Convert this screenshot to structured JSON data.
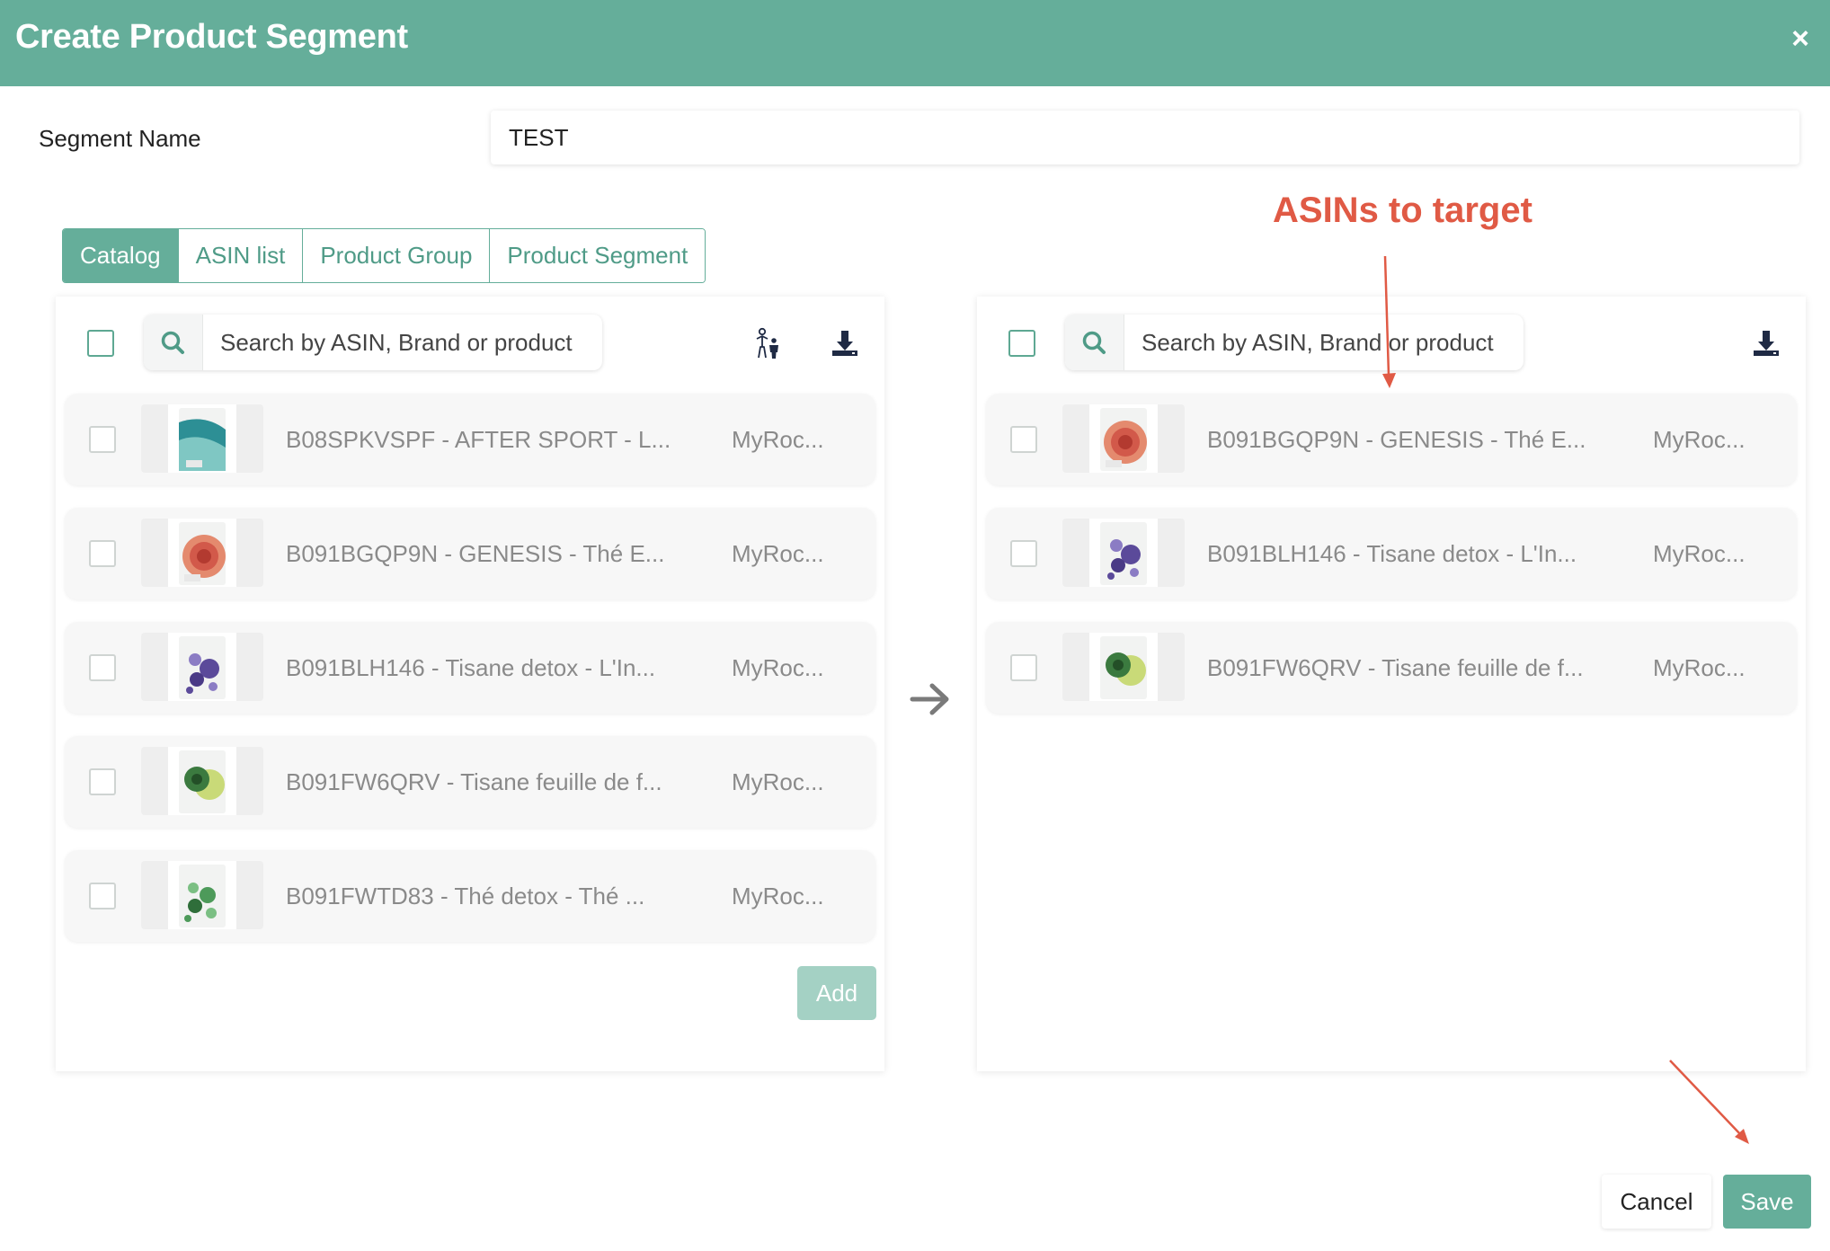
{
  "modal": {
    "title": "Create Product Segment",
    "close_label": "×"
  },
  "segment_name": {
    "label": "Segment Name",
    "value": "TEST"
  },
  "tabs": [
    {
      "label": "Catalog",
      "active": true
    },
    {
      "label": "ASIN list",
      "active": false
    },
    {
      "label": "Product Group",
      "active": false
    },
    {
      "label": "Product Segment",
      "active": false
    }
  ],
  "left_panel": {
    "search_placeholder": "Search by ASIN, Brand or product",
    "icons": [
      "search-icon",
      "family-filter-icon",
      "download-icon"
    ],
    "rows": [
      {
        "title": "B08SPKVSPF - AFTER SPORT - L...",
        "brand": "MyRoc...",
        "thumb_color": "#2d8f95"
      },
      {
        "title": "B091BGQP9N - GENESIS - Thé E...",
        "brand": "MyRoc...",
        "thumb_color": "#d2594a"
      },
      {
        "title": "B091BLH146 - Tisane detox - L'In...",
        "brand": "MyRoc...",
        "thumb_color": "#5b4a9a"
      },
      {
        "title": "B091FW6QRV - Tisane feuille de f...",
        "brand": "MyRoc...",
        "thumb_color": "#3b7a3f"
      },
      {
        "title": "B091FWTD83 - Thé detox - Thé ...",
        "brand": "MyRoc...",
        "thumb_color": "#4d9a5a"
      }
    ],
    "add_label": "Add"
  },
  "right_panel": {
    "search_placeholder": "Search by ASIN, Brand or product",
    "icons": [
      "search-icon",
      "download-icon"
    ],
    "rows": [
      {
        "title": "B091BGQP9N - GENESIS - Thé E...",
        "brand": "MyRoc...",
        "thumb_color": "#d2594a"
      },
      {
        "title": "B091BLH146 - Tisane detox - L'In...",
        "brand": "MyRoc...",
        "thumb_color": "#5b4a9a"
      },
      {
        "title": "B091FW6QRV - Tisane feuille de f...",
        "brand": "MyRoc...",
        "thumb_color": "#3b7a3f"
      }
    ]
  },
  "annotation": {
    "text": "ASINs to target",
    "color": "#e05a45"
  },
  "footer": {
    "cancel_label": "Cancel",
    "save_label": "Save"
  },
  "colors": {
    "brand": "#65ae9a",
    "add_disabled": "#a4d1c4"
  }
}
